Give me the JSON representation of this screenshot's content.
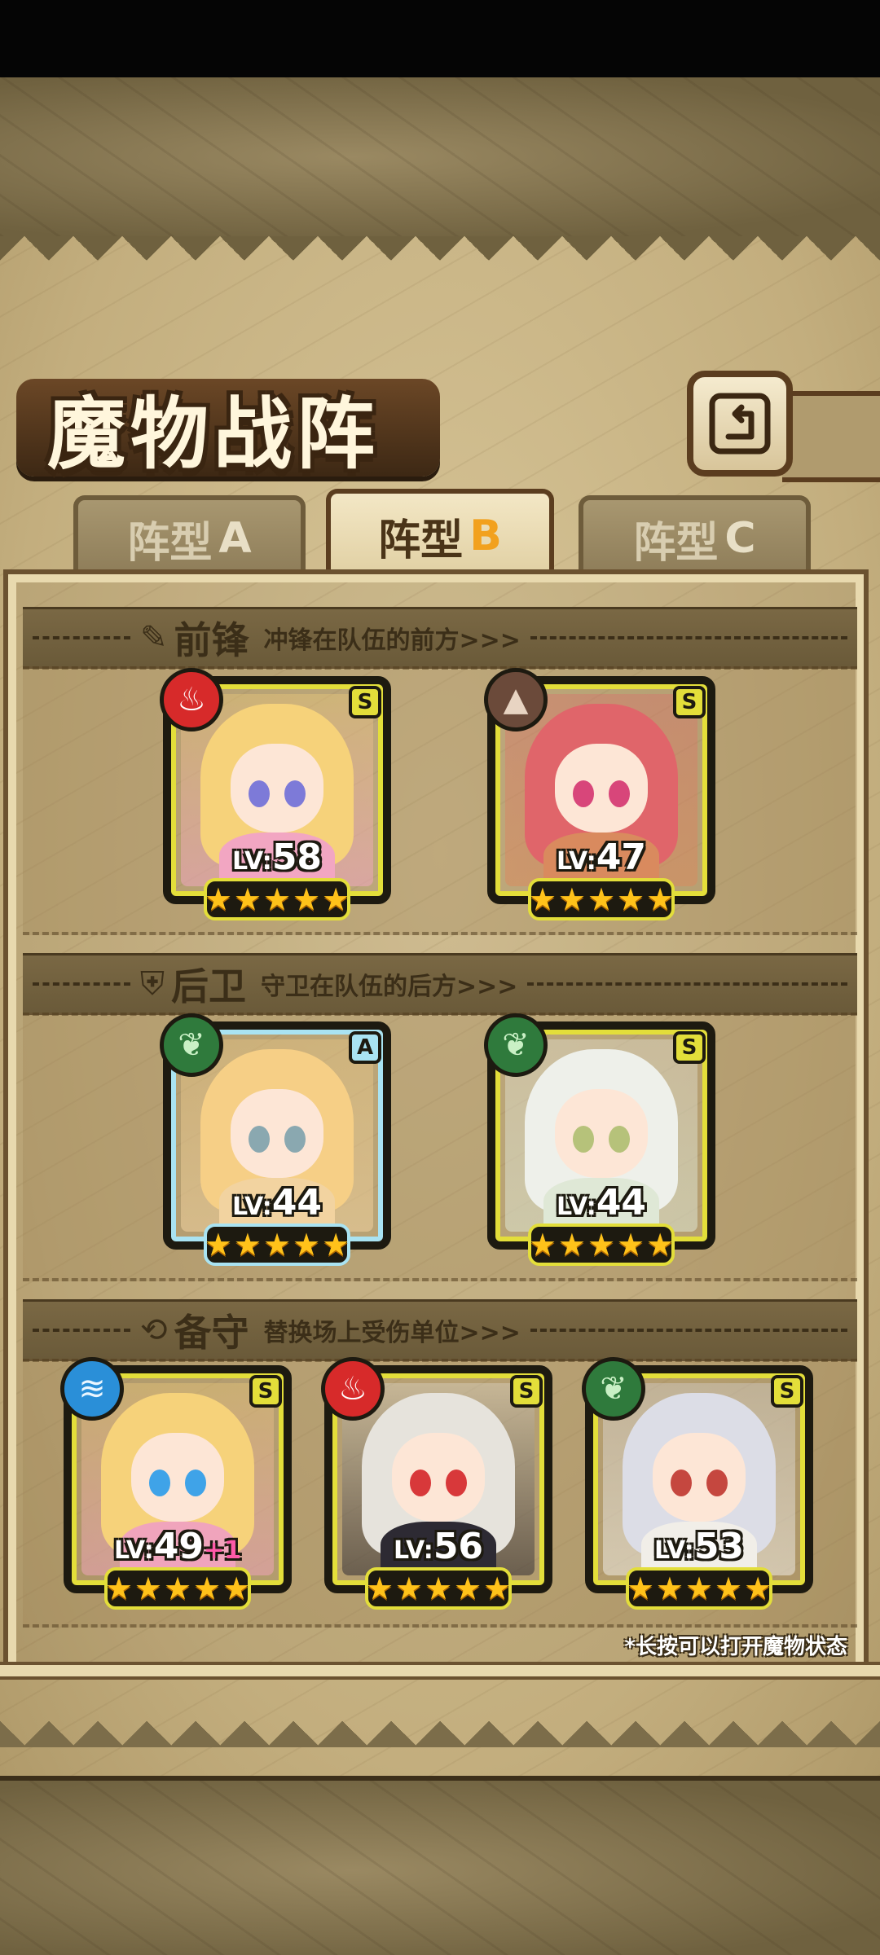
{
  "screen": {
    "title": "魔物战阵"
  },
  "colors": {
    "accent": "#f2a11e",
    "frame": "#e3de3a",
    "frame_rank_a": "#a9e3f2",
    "star": "#ffc21a"
  },
  "header": {
    "back_icon": "back-arrow-icon"
  },
  "tabs": [
    {
      "label": "阵型",
      "letter": "A",
      "selected": false
    },
    {
      "label": "阵型",
      "letter": "B",
      "selected": true
    },
    {
      "label": "阵型",
      "letter": "C",
      "selected": false
    }
  ],
  "sections": {
    "vanguard": {
      "icon": "sword-icon",
      "name": "前锋",
      "desc": "冲锋在队伍的前方>>>"
    },
    "rearguard": {
      "icon": "shield-icon",
      "name": "后卫",
      "desc": "守卫在队伍的后方>>>"
    },
    "reserve": {
      "icon": "swap-icon",
      "name": "备守",
      "desc": "替换场上受伤单位>>>"
    }
  },
  "units": {
    "v1": {
      "lv_prefix": "LV:",
      "level": "58",
      "bonus": "",
      "rank": "S",
      "element": "fire",
      "element_icon": "fire-icon",
      "stars": 5,
      "hair": "#f6d27a",
      "eyes": "#7d7ad8",
      "outfit": "#f2a6c2"
    },
    "v2": {
      "lv_prefix": "LV:",
      "level": "47",
      "bonus": "",
      "rank": "S",
      "element": "earth",
      "element_icon": "mountain-icon",
      "stars": 5,
      "hair": "#e0656a",
      "eyes": "#d8467a",
      "outfit": "#d98a5e"
    },
    "r1": {
      "lv_prefix": "LV:",
      "level": "44",
      "bonus": "",
      "rank": "A",
      "element": "grass",
      "element_icon": "leaf-icon",
      "stars": 5,
      "hair": "#f6cf86",
      "eyes": "#8aa8b0",
      "outfit": "#f2d3a0"
    },
    "r2": {
      "lv_prefix": "LV:",
      "level": "44",
      "bonus": "",
      "rank": "S",
      "element": "grass",
      "element_icon": "leaf-icon",
      "stars": 5,
      "hair": "#eef0ea",
      "eyes": "#b6c27a",
      "outfit": "#dfe8d6"
    },
    "b1": {
      "lv_prefix": "LV:",
      "level": "49",
      "bonus": "+1",
      "rank": "S",
      "element": "water",
      "element_icon": "water-wave-icon",
      "stars": 5,
      "hair": "#f6d27a",
      "eyes": "#3fa3e8",
      "outfit": "#f0a4bc"
    },
    "b2": {
      "lv_prefix": "LV:",
      "level": "56",
      "bonus": "",
      "rank": "S",
      "element": "fire",
      "element_icon": "fire-icon",
      "stars": 5,
      "hair": "#e6e3dc",
      "eyes": "#d8383a",
      "outfit": "#2d2a33"
    },
    "b3": {
      "lv_prefix": "LV:",
      "level": "53",
      "bonus": "",
      "rank": "S",
      "element": "grass",
      "element_icon": "leaf-icon",
      "stars": 5,
      "hair": "#dcdde6",
      "eyes": "#c5473f",
      "outfit": "#f1eee8"
    }
  },
  "footnote": "*长按可以打开魔物状态"
}
